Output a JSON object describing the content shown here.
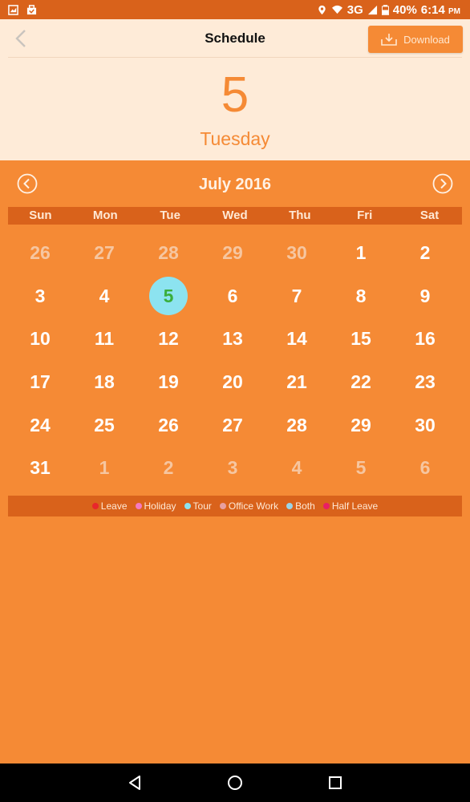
{
  "status_bar": {
    "network": "3G",
    "battery": "40%",
    "time": "6:14",
    "ampm": "PM"
  },
  "header": {
    "title": "Schedule",
    "download_label": "Download"
  },
  "selected": {
    "day": "5",
    "weekday": "Tuesday"
  },
  "calendar": {
    "month_title": "July 2016",
    "weekdays": [
      "Sun",
      "Mon",
      "Tue",
      "Wed",
      "Thu",
      "Fri",
      "Sat"
    ],
    "weeks": [
      [
        {
          "d": "26",
          "m": true
        },
        {
          "d": "27",
          "m": true
        },
        {
          "d": "28",
          "m": true
        },
        {
          "d": "29",
          "m": true
        },
        {
          "d": "30",
          "m": true
        },
        {
          "d": "1",
          "m": false
        },
        {
          "d": "2",
          "m": false
        }
      ],
      [
        {
          "d": "3",
          "m": false
        },
        {
          "d": "4",
          "m": false
        },
        {
          "d": "5",
          "m": false,
          "sel": true
        },
        {
          "d": "6",
          "m": false
        },
        {
          "d": "7",
          "m": false
        },
        {
          "d": "8",
          "m": false
        },
        {
          "d": "9",
          "m": false
        }
      ],
      [
        {
          "d": "10",
          "m": false
        },
        {
          "d": "11",
          "m": false
        },
        {
          "d": "12",
          "m": false
        },
        {
          "d": "13",
          "m": false
        },
        {
          "d": "14",
          "m": false
        },
        {
          "d": "15",
          "m": false
        },
        {
          "d": "16",
          "m": false
        }
      ],
      [
        {
          "d": "17",
          "m": false
        },
        {
          "d": "18",
          "m": false
        },
        {
          "d": "19",
          "m": false
        },
        {
          "d": "20",
          "m": false
        },
        {
          "d": "21",
          "m": false
        },
        {
          "d": "22",
          "m": false
        },
        {
          "d": "23",
          "m": false
        }
      ],
      [
        {
          "d": "24",
          "m": false
        },
        {
          "d": "25",
          "m": false
        },
        {
          "d": "26",
          "m": false
        },
        {
          "d": "27",
          "m": false
        },
        {
          "d": "28",
          "m": false
        },
        {
          "d": "29",
          "m": false
        },
        {
          "d": "30",
          "m": false
        }
      ],
      [
        {
          "d": "31",
          "m": false
        },
        {
          "d": "1",
          "m": true
        },
        {
          "d": "2",
          "m": true
        },
        {
          "d": "3",
          "m": true
        },
        {
          "d": "4",
          "m": true
        },
        {
          "d": "5",
          "m": true
        },
        {
          "d": "6",
          "m": true
        }
      ]
    ]
  },
  "legend": [
    {
      "label": "Leave",
      "color": "#E8262B"
    },
    {
      "label": "Holiday",
      "color": "#F57AC0"
    },
    {
      "label": "Tour",
      "color": "#8CE3F0"
    },
    {
      "label": "Office Work",
      "color": "#E8A0A0"
    },
    {
      "label": "Both",
      "color": "#9BD3E6"
    },
    {
      "label": "Half Leave",
      "color": "#E91E63"
    }
  ],
  "colors": {
    "accent": "#F58A35",
    "dark_accent": "#D9621B",
    "light_panel": "#FEEBD8",
    "selected_circle": "#8CE3F0",
    "selected_text": "#3AAE3C"
  }
}
